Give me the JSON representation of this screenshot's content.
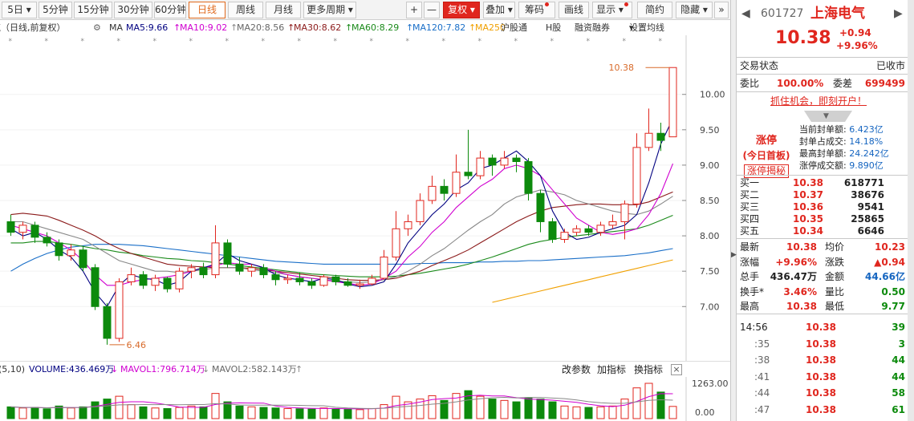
{
  "toolbar": {
    "periods": [
      "5日",
      "5分钟",
      "15分钟",
      "30分钟",
      "60分钟",
      "日线",
      "周线",
      "月线",
      "更多周期"
    ],
    "plus": "+",
    "minus": "—",
    "fuquan": "复权",
    "diejia": "叠加",
    "chouma": "筹码",
    "huaxian": "画线",
    "xianshi": "显示",
    "jianyue": "简约",
    "yincang": "隐藏"
  },
  "mabar": {
    "title": "贰（日线,前复权）",
    "ma": "MA",
    "ma5": "MA5:9.66",
    "ma10": "MA10:9.02",
    "ma20": "MA20:8.56",
    "ma30": "MA30:8.62",
    "ma60": "MA60:8.29",
    "ma120": "MA120:7.82",
    "ma250": "MA250",
    "hgt": "沪股通",
    "hgu": "H股",
    "rzrq": "融资融券",
    "setma": "设置均线"
  },
  "colors": {
    "up": "#e0261e",
    "down": "#0c8a0c",
    "ma5": "#000080",
    "ma10": "#d000d0",
    "ma20": "#888888",
    "ma30": "#8b1a1a",
    "ma60": "#1a8a1a",
    "ma120": "#1a6fc8",
    "ma250": "#f0a000"
  },
  "chart_data": {
    "type": "candlestick",
    "y_ticks": [
      "10.00",
      "9.50",
      "9.00",
      "8.50",
      "8.00",
      "7.50",
      "7.00"
    ],
    "ylim": [
      6.3,
      10.7
    ],
    "high_label": "10.38",
    "low_label": "6.46",
    "ma5": [
      8.1,
      8.0,
      8.05,
      7.95,
      7.8,
      7.7,
      7.5,
      7.2,
      7.0,
      7.3,
      7.45,
      7.4,
      7.38,
      7.3,
      7.35,
      7.5,
      7.55,
      7.6,
      7.75,
      7.65,
      7.6,
      7.55,
      7.45,
      7.4,
      7.38,
      7.35,
      7.4,
      7.38,
      7.32,
      7.28,
      7.3,
      7.35,
      7.6,
      7.9,
      8.1,
      8.3,
      8.45,
      8.65,
      8.75,
      8.95,
      9.0,
      9.1,
      9.2,
      9.05,
      8.85,
      8.35,
      8.05,
      7.95,
      7.98,
      8.05,
      8.1,
      8.15,
      8.3,
      8.75,
      9.3,
      9.66
    ],
    "ma10": [
      8.15,
      8.1,
      8.05,
      8.0,
      7.9,
      7.8,
      7.65,
      7.45,
      7.3,
      7.3,
      7.35,
      7.38,
      7.4,
      7.42,
      7.45,
      7.5,
      7.55,
      7.58,
      7.62,
      7.6,
      7.6,
      7.55,
      7.5,
      7.45,
      7.42,
      7.4,
      7.38,
      7.35,
      7.33,
      7.3,
      7.32,
      7.4,
      7.5,
      7.7,
      7.85,
      8.05,
      8.2,
      8.4,
      8.55,
      8.7,
      8.8,
      8.95,
      9.0,
      8.95,
      8.85,
      8.65,
      8.45,
      8.25,
      8.15,
      8.05,
      8.02,
      8.05,
      8.1,
      8.3,
      8.6,
      9.02
    ],
    "ma20": [
      8.2,
      8.2,
      8.15,
      8.1,
      8.05,
      8.0,
      7.95,
      7.85,
      7.75,
      7.65,
      7.6,
      7.55,
      7.5,
      7.5,
      7.48,
      7.5,
      7.52,
      7.55,
      7.55,
      7.55,
      7.52,
      7.5,
      7.48,
      7.45,
      7.42,
      7.4,
      7.38,
      7.36,
      7.35,
      7.34,
      7.35,
      7.38,
      7.42,
      7.5,
      7.6,
      7.72,
      7.82,
      7.95,
      8.08,
      8.2,
      8.3,
      8.45,
      8.55,
      8.6,
      8.65,
      8.62,
      8.58,
      8.5,
      8.45,
      8.4,
      8.35,
      8.32,
      8.3,
      8.35,
      8.45,
      8.56
    ],
    "ma30": [
      8.3,
      8.32,
      8.3,
      8.28,
      8.22,
      8.15,
      8.08,
      8.0,
      7.9,
      7.82,
      7.75,
      7.7,
      7.65,
      7.6,
      7.58,
      7.57,
      7.56,
      7.55,
      7.55,
      7.55,
      7.54,
      7.52,
      7.5,
      7.48,
      7.46,
      7.44,
      7.42,
      7.4,
      7.38,
      7.37,
      7.37,
      7.38,
      7.4,
      7.45,
      7.5,
      7.58,
      7.65,
      7.72,
      7.8,
      7.9,
      8.0,
      8.1,
      8.2,
      8.28,
      8.35,
      8.4,
      8.42,
      8.44,
      8.45,
      8.45,
      8.44,
      8.44,
      8.44,
      8.48,
      8.55,
      8.62
    ],
    "ma60": [
      7.9,
      7.9,
      7.92,
      7.92,
      7.9,
      7.88,
      7.85,
      7.82,
      7.8,
      7.77,
      7.75,
      7.72,
      7.7,
      7.68,
      7.67,
      7.65,
      7.64,
      7.62,
      7.6,
      7.58,
      7.56,
      7.54,
      7.52,
      7.5,
      7.48,
      7.46,
      7.45,
      7.44,
      7.43,
      7.42,
      7.42,
      7.42,
      7.43,
      7.45,
      7.47,
      7.5,
      7.53,
      7.56,
      7.6,
      7.65,
      7.7,
      7.76,
      7.82,
      7.88,
      7.92,
      7.95,
      7.98,
      8.0,
      8.02,
      8.04,
      8.06,
      8.08,
      8.1,
      8.15,
      8.22,
      8.29
    ],
    "ma120": [
      7.5,
      7.6,
      7.68,
      7.75,
      7.8,
      7.84,
      7.86,
      7.88,
      7.88,
      7.88,
      7.87,
      7.86,
      7.84,
      7.82,
      7.8,
      7.78,
      7.76,
      7.74,
      7.72,
      7.7,
      7.68,
      7.66,
      7.64,
      7.63,
      7.62,
      7.61,
      7.6,
      7.6,
      7.6,
      7.6,
      7.6,
      7.6,
      7.6,
      7.6,
      7.61,
      7.61,
      7.62,
      7.62,
      7.62,
      7.63,
      7.63,
      7.64,
      7.64,
      7.65,
      7.65,
      7.66,
      7.67,
      7.68,
      7.69,
      7.7,
      7.71,
      7.72,
      7.74,
      7.76,
      7.79,
      7.82
    ],
    "ma250_start_index": 40,
    "ma250": [
      7.06,
      7.1,
      7.14,
      7.18,
      7.22,
      7.26,
      7.3,
      7.34,
      7.38,
      7.42,
      7.46,
      7.5,
      7.54,
      7.58,
      7.62,
      7.66
    ],
    "candles": [
      [
        8.2,
        8.05,
        8.3,
        8.0
      ],
      [
        8.05,
        8.15,
        8.2,
        7.95
      ],
      [
        8.15,
        7.98,
        8.2,
        7.9
      ],
      [
        7.98,
        7.9,
        8.05,
        7.85
      ],
      [
        7.9,
        7.72,
        7.95,
        7.65
      ],
      [
        7.72,
        7.8,
        7.88,
        7.65
      ],
      [
        7.8,
        7.55,
        7.85,
        7.5
      ],
      [
        7.55,
        7.0,
        7.6,
        6.95
      ],
      [
        7.0,
        6.55,
        7.05,
        6.46
      ],
      [
        6.55,
        7.35,
        7.4,
        6.5
      ],
      [
        7.35,
        7.45,
        7.55,
        7.3
      ],
      [
        7.45,
        7.3,
        7.5,
        7.25
      ],
      [
        7.3,
        7.4,
        7.45,
        7.22
      ],
      [
        7.4,
        7.25,
        7.42,
        7.2
      ],
      [
        7.25,
        7.5,
        7.55,
        7.2
      ],
      [
        7.5,
        7.55,
        7.6,
        7.4
      ],
      [
        7.55,
        7.45,
        7.62,
        7.4
      ],
      [
        7.45,
        7.9,
        8.15,
        7.4
      ],
      [
        7.9,
        7.6,
        7.95,
        7.55
      ],
      [
        7.6,
        7.5,
        7.7,
        7.45
      ],
      [
        7.5,
        7.55,
        7.6,
        7.42
      ],
      [
        7.55,
        7.45,
        7.6,
        7.4
      ],
      [
        7.45,
        7.38,
        7.5,
        7.3
      ],
      [
        7.38,
        7.4,
        7.45,
        7.32
      ],
      [
        7.4,
        7.35,
        7.48,
        7.3
      ],
      [
        7.35,
        7.3,
        7.4,
        7.25
      ],
      [
        7.3,
        7.42,
        7.45,
        7.28
      ],
      [
        7.42,
        7.35,
        7.45,
        7.3
      ],
      [
        7.35,
        7.3,
        7.4,
        7.28
      ],
      [
        7.3,
        7.32,
        7.38,
        7.25
      ],
      [
        7.32,
        7.4,
        7.45,
        7.3
      ],
      [
        7.4,
        7.7,
        7.8,
        7.38
      ],
      [
        7.7,
        8.1,
        8.35,
        7.65
      ],
      [
        8.1,
        8.2,
        8.3,
        8.0
      ],
      [
        8.2,
        8.5,
        8.6,
        8.15
      ],
      [
        8.5,
        8.7,
        8.85,
        8.45
      ],
      [
        8.7,
        8.6,
        8.8,
        8.5
      ],
      [
        8.6,
        8.9,
        9.15,
        8.55
      ],
      [
        8.9,
        8.85,
        9.5,
        8.8
      ],
      [
        8.85,
        9.1,
        9.2,
        8.8
      ],
      [
        9.1,
        9.0,
        9.15,
        8.85
      ],
      [
        9.0,
        9.1,
        9.2,
        8.95
      ],
      [
        9.1,
        9.05,
        9.15,
        8.9
      ],
      [
        9.05,
        8.6,
        9.1,
        8.5
      ],
      [
        8.6,
        8.2,
        8.65,
        8.05
      ],
      [
        8.2,
        7.95,
        8.25,
        7.9
      ],
      [
        7.95,
        8.05,
        8.1,
        7.9
      ],
      [
        8.05,
        8.1,
        8.15,
        8.0
      ],
      [
        8.1,
        8.05,
        8.15,
        8.0
      ],
      [
        8.05,
        8.15,
        8.2,
        8.0
      ],
      [
        8.15,
        8.2,
        8.3,
        8.1
      ],
      [
        8.2,
        8.45,
        8.5,
        7.95
      ],
      [
        8.45,
        9.25,
        9.45,
        8.4
      ],
      [
        9.25,
        9.45,
        9.8,
        9.2
      ],
      [
        9.45,
        9.35,
        9.6,
        9.2
      ],
      [
        9.4,
        10.38,
        10.38,
        9.4
      ]
    ],
    "volume": {
      "label": "VOLUME:436.469万",
      "mavol1": "MAVOL1:796.714万",
      "mavol2": "MAVOL2:582.143万",
      "max_label": "1263.00",
      "zero_label": "0.00",
      "values": [
        420,
        380,
        400,
        350,
        450,
        380,
        420,
        600,
        700,
        800,
        500,
        420,
        380,
        360,
        400,
        450,
        420,
        900,
        600,
        450,
        420,
        400,
        380,
        360,
        350,
        340,
        380,
        360,
        340,
        320,
        360,
        500,
        800,
        600,
        700,
        820,
        650,
        900,
        1000,
        800,
        700,
        650,
        600,
        750,
        700,
        600,
        450,
        420,
        400,
        420,
        450,
        700,
        1100,
        1263,
        950,
        436
      ]
    },
    "status": "(5,10)",
    "gaicanshu": "改参数",
    "jiazhibiao": "加指标",
    "huanzhibiao": "换指标"
  },
  "quote": {
    "code": "601727",
    "name": "上海电气",
    "price": "10.38",
    "chg": "+0.94",
    "pct": "+9.96%",
    "state_label": "交易状态",
    "state_value": "已收市",
    "weibi_label": "委比",
    "weibi_value": "100.00%",
    "weicha_label": "委差",
    "weicha_value": "699499",
    "ad": "抓住机会，即刻开户！",
    "zt_title": "涨停",
    "zt_sub": "(今日首板)",
    "zt_btn": "涨停揭秘",
    "zt_rows": [
      [
        "当前封单额:",
        "6.423亿"
      ],
      [
        "封单占成交:",
        "14.18%"
      ],
      [
        "最高封单额:",
        "24.242亿"
      ],
      [
        "涨停成交额:",
        "9.890亿"
      ]
    ],
    "buy": [
      [
        "买一",
        "10.38",
        "618771"
      ],
      [
        "买二",
        "10.37",
        "38676"
      ],
      [
        "买三",
        "10.36",
        "9541"
      ],
      [
        "买四",
        "10.35",
        "25865"
      ],
      [
        "买五",
        "10.34",
        "6646"
      ]
    ],
    "stats": [
      [
        "最新",
        "10.38",
        "均价",
        "10.23"
      ],
      [
        "涨幅",
        "+9.96%",
        "涨跌",
        "▲0.94"
      ],
      [
        "总手",
        "436.47万",
        "金额",
        "44.66亿"
      ],
      [
        "换手*",
        "3.46%",
        "量比",
        "0.50"
      ],
      [
        "最高",
        "10.38",
        "最低",
        "9.77"
      ]
    ],
    "ticks": [
      [
        "14:56",
        "10.38",
        "39"
      ],
      [
        ":35",
        "10.38",
        "3"
      ],
      [
        ":38",
        "10.38",
        "44"
      ],
      [
        ":41",
        "10.38",
        "44"
      ],
      [
        ":44",
        "10.38",
        "58"
      ],
      [
        ":47",
        "10.38",
        "61"
      ]
    ]
  }
}
